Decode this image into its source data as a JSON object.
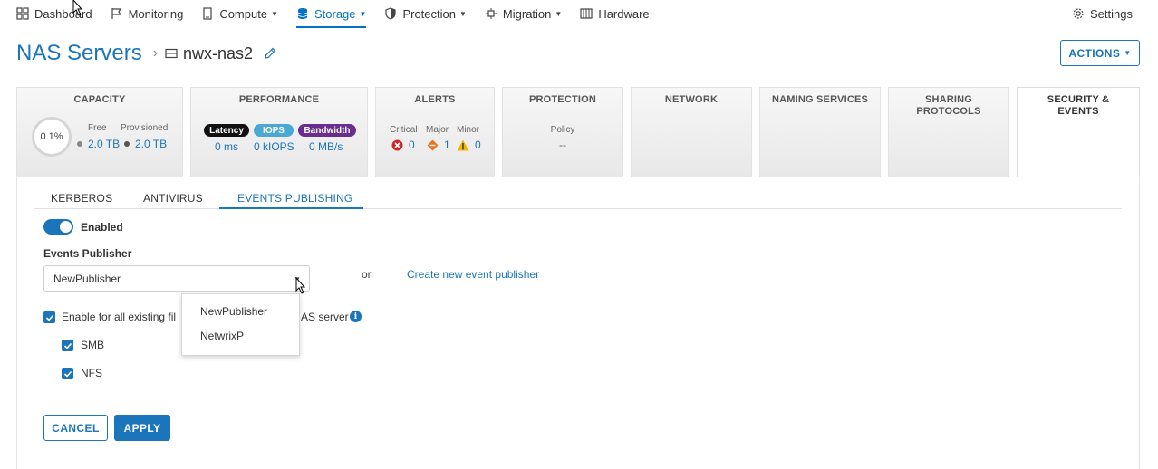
{
  "nav": {
    "dashboard": "Dashboard",
    "monitoring": "Monitoring",
    "compute": "Compute",
    "storage": "Storage",
    "protection": "Protection",
    "migration": "Migration",
    "hardware": "Hardware",
    "settings": "Settings"
  },
  "header": {
    "title": "NAS Servers",
    "server_name": "nwx-nas2",
    "actions_label": "ACTIONS"
  },
  "cards": {
    "capacity": {
      "title": "CAPACITY",
      "percent": "0.1%",
      "free_label": "Free",
      "provisioned_label": "Provisioned",
      "free_value": "2.0 TB",
      "provisioned_value": "2.0 TB"
    },
    "performance": {
      "title": "PERFORMANCE",
      "latency_label": "Latency",
      "iops_label": "IOPS",
      "bandwidth_label": "Bandwidth",
      "latency_value": "0 ms",
      "iops_value": "0 kIOPS",
      "bandwidth_value": "0 MB/s"
    },
    "alerts": {
      "title": "ALERTS",
      "critical_label": "Critical",
      "major_label": "Major",
      "minor_label": "Minor",
      "critical_value": "0",
      "major_value": "1",
      "minor_value": "0"
    },
    "protection": {
      "title": "PROTECTION",
      "policy_label": "Policy",
      "policy_value": "--"
    },
    "network": {
      "title": "NETWORK"
    },
    "naming": {
      "title": "NAMING SERVICES"
    },
    "sharing": {
      "title_line1": "SHARING",
      "title_line2": "PROTOCOLS"
    },
    "security": {
      "title_line1": "SECURITY &",
      "title_line2": "EVENTS"
    }
  },
  "subtabs": {
    "kerberos": "KERBEROS",
    "antivirus": "ANTIVIRUS",
    "events_publishing": "EVENTS PUBLISHING"
  },
  "form": {
    "enabled_label": "Enabled",
    "events_publisher_label": "Events Publisher",
    "selected_publisher": "NewPublisher",
    "or_text": "or",
    "create_link": "Create new event publisher",
    "enable_all_label_start": "Enable for all existing fil",
    "enable_all_label_end": "AS server",
    "smb_label": "SMB",
    "nfs_label": "NFS",
    "dropdown_options": [
      "NewPublisher",
      "NetwrixP"
    ],
    "cancel_label": "CANCEL",
    "apply_label": "APPLY"
  },
  "colors": {
    "accent": "#1b75bb",
    "latency_pill": "#111111",
    "iops_pill": "#49a8d4",
    "bandwidth_pill": "#6b2c8f",
    "critical": "#d0262a",
    "major": "#e8731c",
    "minor": "#f2b600"
  }
}
